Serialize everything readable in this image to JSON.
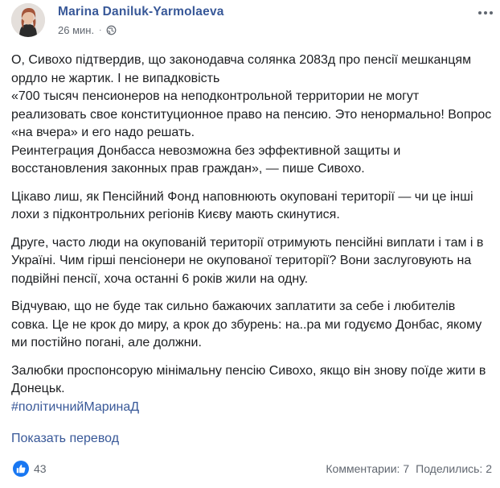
{
  "post": {
    "author": "Marina Daniluk-Yarmolaeva",
    "time": "26 мин.",
    "separator": "·",
    "icons": {
      "privacy": "globe-icon",
      "options": "more-options-icon",
      "reaction": "like-icon"
    },
    "paragraphs": [
      "О, Сивохо підтвердив, що законодавча солянка 2083д про пенсії мешканцям ордло не жартик. І не випадковість\n«700 тысяч пенсионеров на неподконтрольной территории не могут реализовать свое конституционное право на пенсию. Это ненормально! Вопрос «на вчера» и его надо решать.\nРеинтеграция Донбасса невозможна без эффективной защиты и восстановления законных прав граждан», — пише Сивохо.",
      "Цікаво лиш, як Пенсійний Фонд наповнюють окуповані території — чи це інші лохи з підконтрольних регіонів Києву мають скинутися.",
      "Друге, часто люди на окупованій території отримують пенсійні виплати і там і в Україні. Чим гірші пенсіонери не окупованої території? Вони заслуговують на подвійні пенсії, хоча останні 6 років жили на одну.",
      "Відчуваю, що не буде так сильно бажаючих заплатити за себе і любителів совка. Це не крок до миру, а крок до збурень: на..ра ми годуємо Донбас, якому ми постійно погані, але должни.",
      "Залюбки проспонсорую мінімальну пенсію Сивохо, якщо він знову поїде жити в Донецьк."
    ],
    "hashtag": "#політичнийМаринаД",
    "translate_link": "Показать перевод",
    "reactions_count": "43",
    "comments": "Комментарии: 7",
    "shares": "Поделились: 2"
  },
  "colors": {
    "link": "#385898",
    "meta": "#616770",
    "text": "#1c1e21",
    "like": "#1877f2"
  }
}
